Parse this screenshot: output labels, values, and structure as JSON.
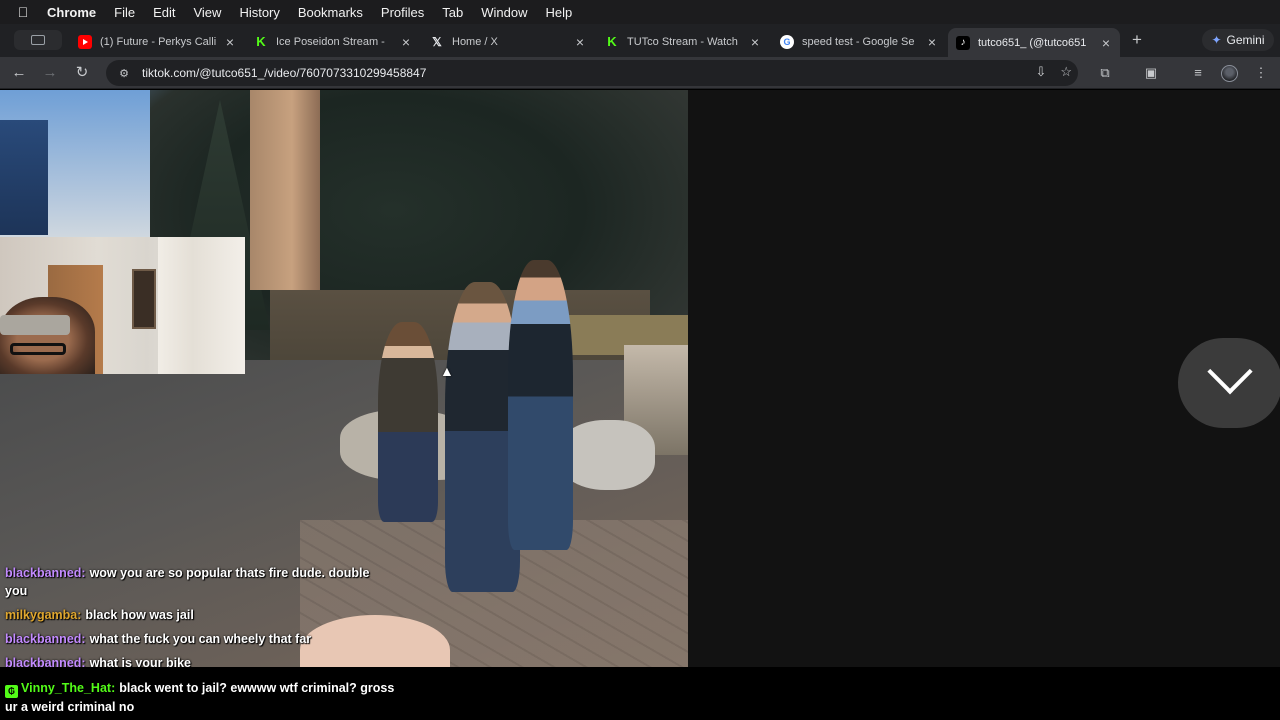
{
  "menubar": {
    "app": "Chrome",
    "items": [
      "File",
      "Edit",
      "View",
      "History",
      "Bookmarks",
      "Profiles",
      "Tab",
      "Window",
      "Help"
    ]
  },
  "tabs": [
    {
      "title": "(1) Future - Perkys Calli",
      "icon": "youtube-icon",
      "active": false
    },
    {
      "title": "Ice Poseidon Stream - ",
      "icon": "kick-icon",
      "active": false
    },
    {
      "title": "Home / X",
      "icon": "x-icon",
      "active": false
    },
    {
      "title": "TUTco Stream - Watch",
      "icon": "kick-icon",
      "active": false
    },
    {
      "title": "speed test - Google Se",
      "icon": "google-icon",
      "active": false
    },
    {
      "title": "tutco651_ (@tutco651",
      "icon": "tiktok-icon",
      "active": true
    }
  ],
  "gemini_label": "Gemini",
  "address_bar": {
    "url": "tiktok.com/@tutco651_/video/7607073310299458847"
  },
  "chat": [
    {
      "user": "blackbanned:",
      "text": "wow you are so popular thats fire dude. double you",
      "color": "purple"
    },
    {
      "user": "milkygamba:",
      "text": "black how was jail",
      "color": "gold"
    },
    {
      "user": "blackbanned:",
      "text": "what the fuck you can wheely that far",
      "color": "purple"
    },
    {
      "user": "blackbanned:",
      "text": "what is your bike",
      "color": "purple"
    }
  ],
  "chat_bottom": {
    "user": "Vinny_The_Hat:",
    "text": "black went to jail? ewwww wtf criminal? gross ur a weird criminal no",
    "badge": "₲"
  },
  "icons": {
    "back": "←",
    "forward": "→",
    "reload": "↻",
    "close": "×",
    "new_tab": "+"
  }
}
